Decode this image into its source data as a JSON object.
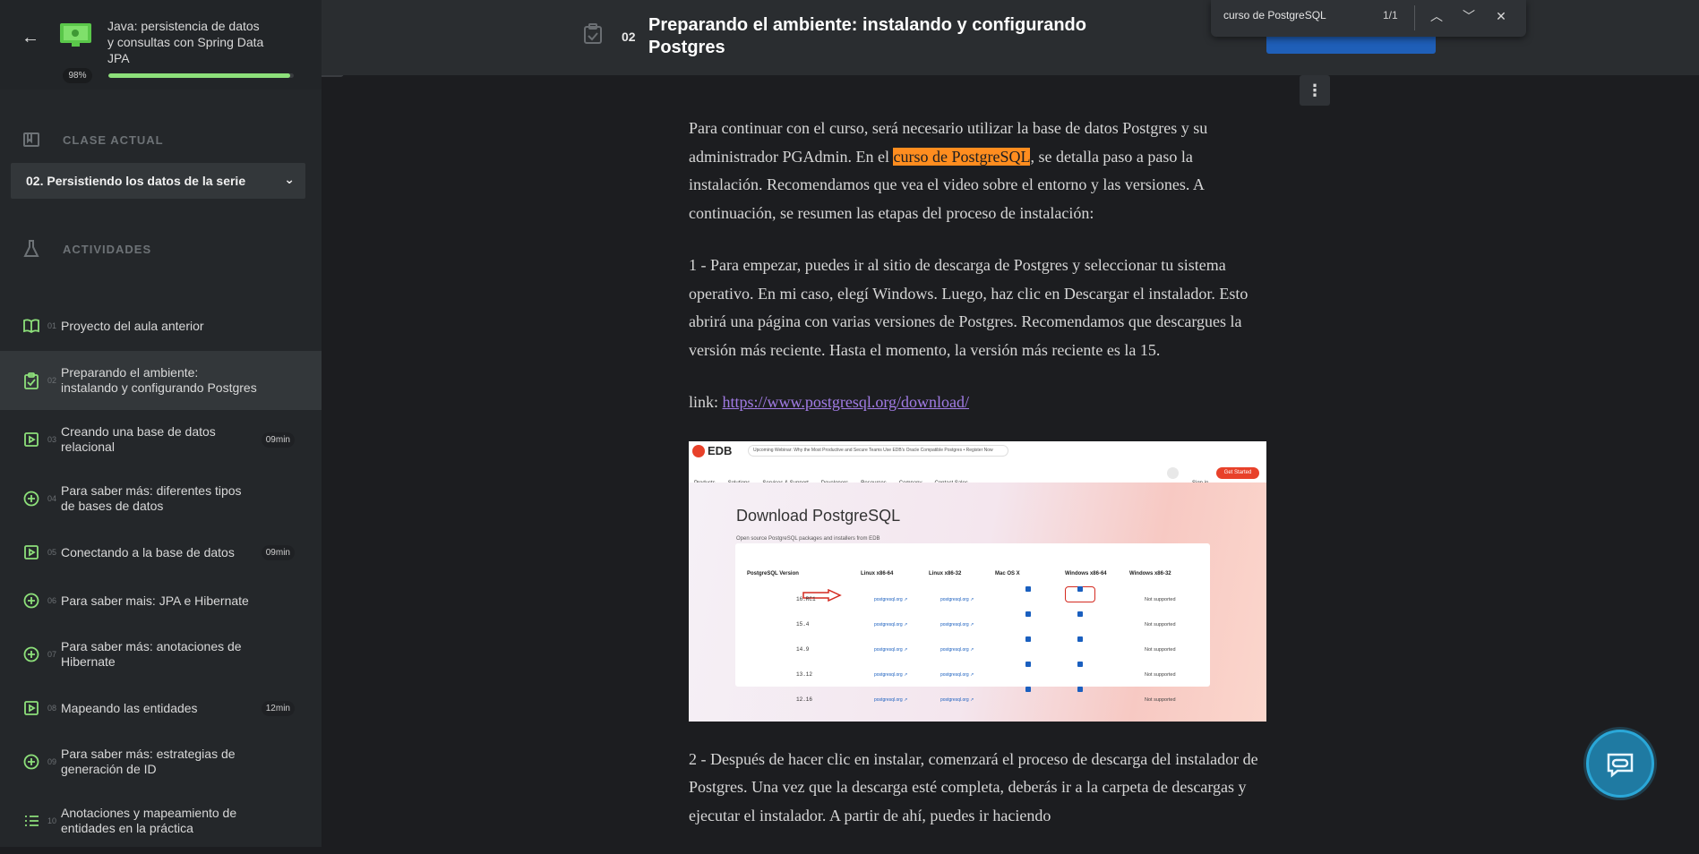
{
  "sidebar": {
    "course_title": "Java: persistencia de datos y consultas con Spring Data JPA",
    "progress_label": "98%",
    "progress_value": 0.98,
    "current_class_label": "CLASE ACTUAL",
    "current_class": "02. Persistiendo los datos de la serie",
    "activities_label": "ACTIVIDADES",
    "activities": [
      {
        "num": "01",
        "title": "Proyecto del aula anterior",
        "icon": "book-icon",
        "time": ""
      },
      {
        "num": "02",
        "title": "Preparando el ambiente: instalando y configurando Postgres",
        "icon": "clipboard-check-icon",
        "time": ""
      },
      {
        "num": "03",
        "title": "Creando una base de datos relacional",
        "icon": "video-icon",
        "time": "09min"
      },
      {
        "num": "04",
        "title": "Para saber más: diferentes tipos de bases de datos",
        "icon": "plus-circle-icon",
        "time": ""
      },
      {
        "num": "05",
        "title": "Conectando a la base de datos",
        "icon": "video-icon",
        "time": "09min"
      },
      {
        "num": "06",
        "title": "Para saber mais: JPA e Hibernate",
        "icon": "plus-circle-icon",
        "time": ""
      },
      {
        "num": "07",
        "title": "Para saber más: anotaciones de Hibernate",
        "icon": "plus-circle-icon",
        "time": ""
      },
      {
        "num": "08",
        "title": "Mapeando las entidades",
        "icon": "video-icon",
        "time": "12min"
      },
      {
        "num": "09",
        "title": "Para saber más: estrategias de generación de ID",
        "icon": "plus-circle-icon",
        "time": ""
      },
      {
        "num": "10",
        "title": "Anotaciones y mapeamiento de entidades en la práctica",
        "icon": "list-icon",
        "time": ""
      }
    ]
  },
  "header": {
    "num": "02",
    "title": "Preparando el ambiente: instalando y configurando Postgres"
  },
  "find": {
    "query": "curso de PostgreSQL",
    "count": "1/1"
  },
  "content": {
    "p1_before": "Para continuar con el curso, será necesario utilizar la base de datos Postgres y su administrador PGAdmin. En el ",
    "p1_highlight": "curso de PostgreSQL",
    "p1_after": ", se detalla paso a paso la instalación. Recomendamos que vea el video sobre el entorno y las versiones. A continuación, se resumen las etapas del proceso de instalación:",
    "p2": "1 - Para empezar, puedes ir al sitio de descarga de Postgres y seleccionar tu sistema operativo. En mi caso, elegí Windows. Luego, haz clic en Descargar el instalador. Esto abrirá una página con varias versiones de Postgres. Recomendamos que descargues la versión más reciente. Hasta el momento, la versión más reciente es la 15.",
    "link_label": "link: ",
    "link_url": "https://www.postgresql.org/download/",
    "p3": "2 - Después de hacer clic en instalar, comenzará el proceso de descarga del instalador de Postgres. Una vez que la descarga esté completa, deberás ir a la carpeta de descargas y ejecutar el instalador. A partir de ahí, puedes ir haciendo"
  },
  "screenshot": {
    "logo": "EDB",
    "webinar": "Upcoming Webinar: Why the Most Productive and Secure Teams Use EDB's Oracle Compatible Postgres • Register Now",
    "nav": [
      "Products",
      "Solutions",
      "Services & Support",
      "Developers",
      "Resources",
      "Company",
      "Contact Sales"
    ],
    "signin": "Sign in",
    "get_started": "Get Started",
    "heading": "Download PostgreSQL",
    "subheading": "Open source PostgreSQL packages and installers from EDB",
    "columns": [
      "PostgreSQL Version",
      "Linux x86-64",
      "Linux x86-32",
      "Mac OS X",
      "Windows x86-64",
      "Windows x86-32"
    ],
    "versions": [
      "16.RC1",
      "15.4",
      "14.9",
      "13.12",
      "12.16"
    ],
    "linux_link": "postgresql.org",
    "not_supported": "Not supported"
  },
  "colors": {
    "accent_green": "#8de07a",
    "highlight": "#ff8d1f",
    "link": "#a27ce6",
    "next_button": "#1f5fb8"
  }
}
